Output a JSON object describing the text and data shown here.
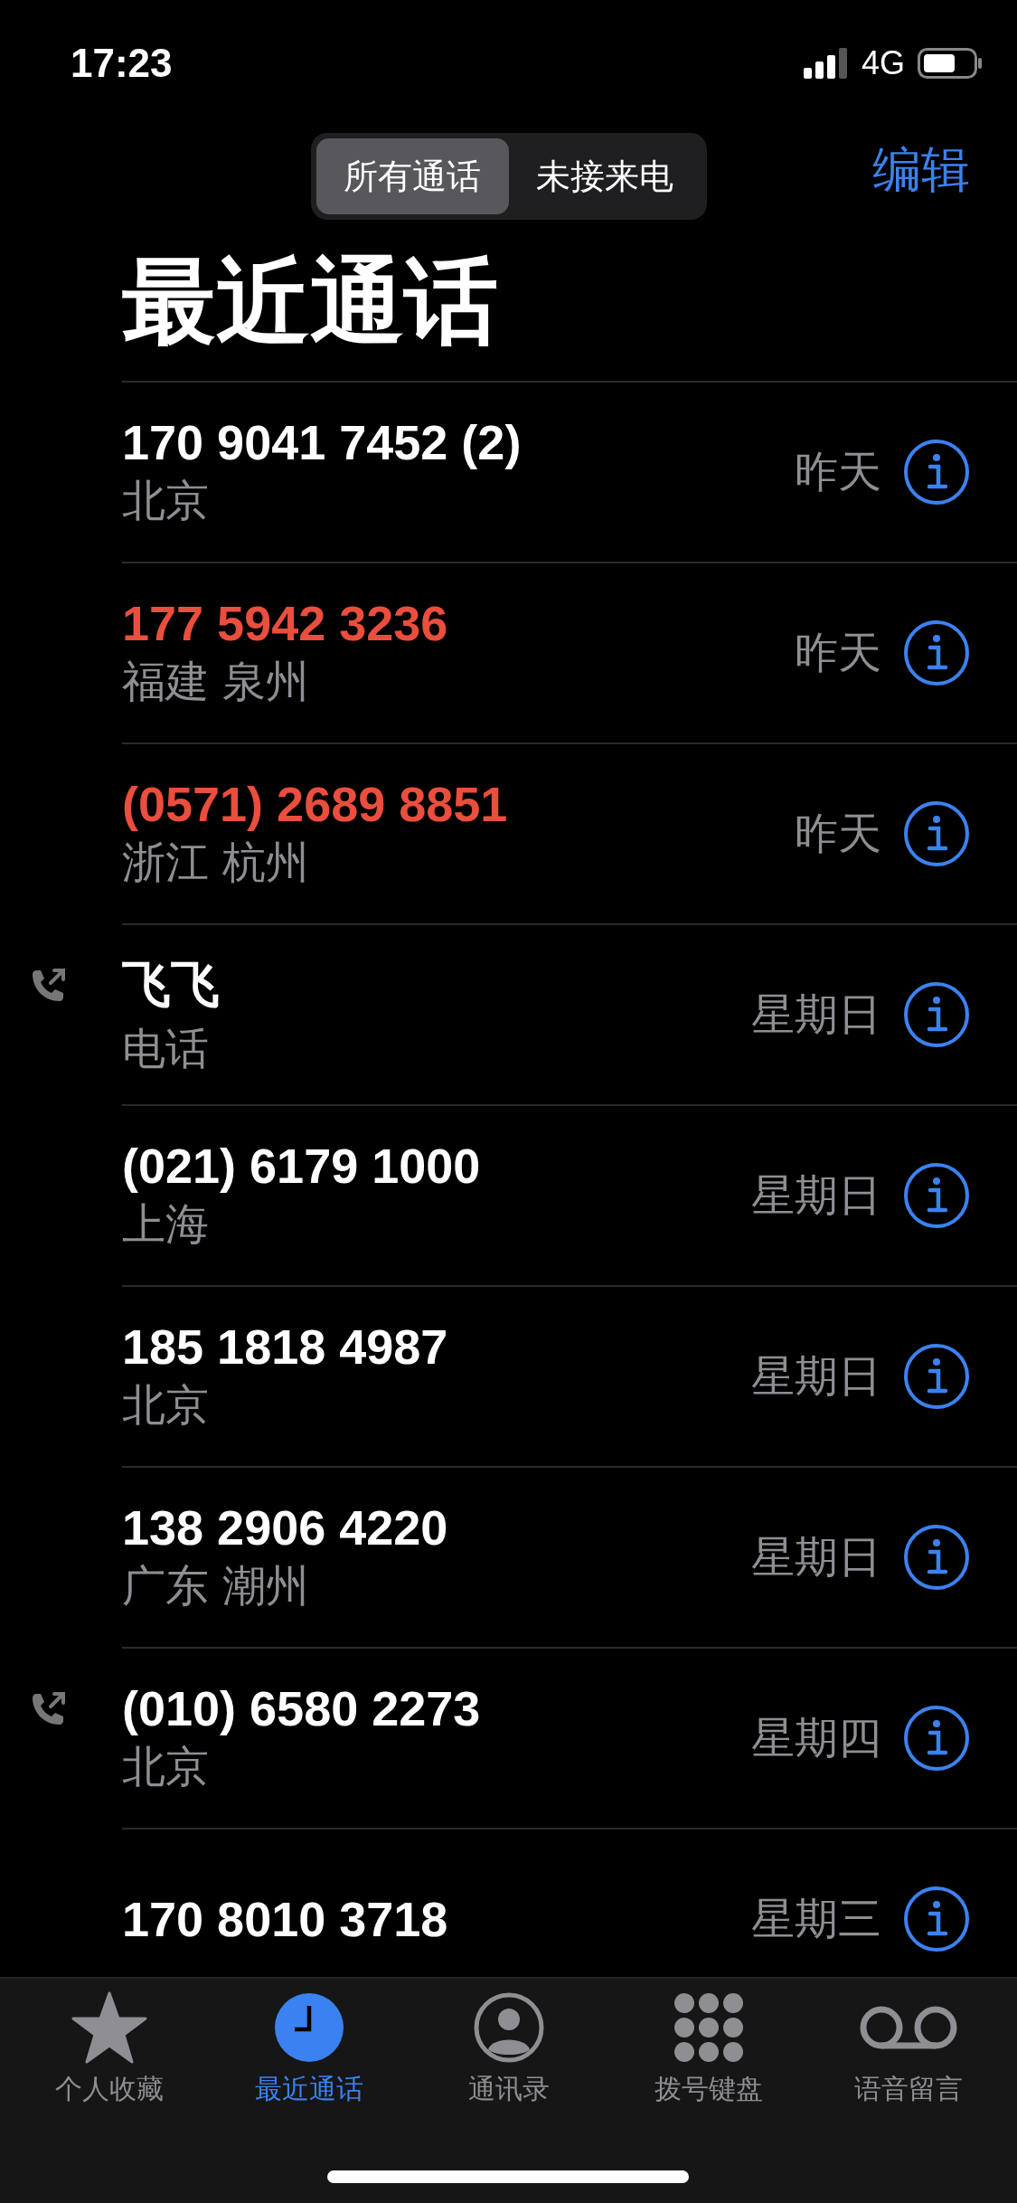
{
  "status_bar": {
    "time": "17:23",
    "network": "4G"
  },
  "segments": [
    {
      "label": "所有通话",
      "selected": true
    },
    {
      "label": "未接来电",
      "selected": false
    }
  ],
  "edit_button": "编辑",
  "title": "最近通话",
  "calls": [
    {
      "number": "170 9041 7452 (2)",
      "location": "北京",
      "date": "昨天",
      "missed": false,
      "outgoing": false
    },
    {
      "number": "177 5942 3236",
      "location": "福建 泉州",
      "date": "昨天",
      "missed": true,
      "outgoing": false
    },
    {
      "number": "(0571) 2689 8851",
      "location": "浙江 杭州",
      "date": "昨天",
      "missed": true,
      "outgoing": false
    },
    {
      "number": "飞飞",
      "location": "电话",
      "date": "星期日",
      "missed": false,
      "outgoing": true
    },
    {
      "number": "(021) 6179 1000",
      "location": "上海",
      "date": "星期日",
      "missed": false,
      "outgoing": false
    },
    {
      "number": "185 1818 4987",
      "location": "北京",
      "date": "星期日",
      "missed": false,
      "outgoing": false
    },
    {
      "number": "138 2906 4220",
      "location": "广东 潮州",
      "date": "星期日",
      "missed": false,
      "outgoing": false
    },
    {
      "number": "(010) 6580 2273",
      "location": "北京",
      "date": "星期四",
      "missed": false,
      "outgoing": true
    },
    {
      "number": "170 8010 3718",
      "date": "星期三",
      "missed": false,
      "outgoing": false
    }
  ],
  "tab_bar": [
    {
      "kind": "star",
      "label": "个人收藏",
      "selected": false
    },
    {
      "kind": "clock",
      "label": "最近通话",
      "selected": true
    },
    {
      "kind": "person",
      "label": "通讯录",
      "selected": false
    },
    {
      "kind": "keypad",
      "label": "拨号键盘",
      "selected": false
    },
    {
      "kind": "voicemail",
      "label": "语音留言",
      "selected": false
    }
  ]
}
